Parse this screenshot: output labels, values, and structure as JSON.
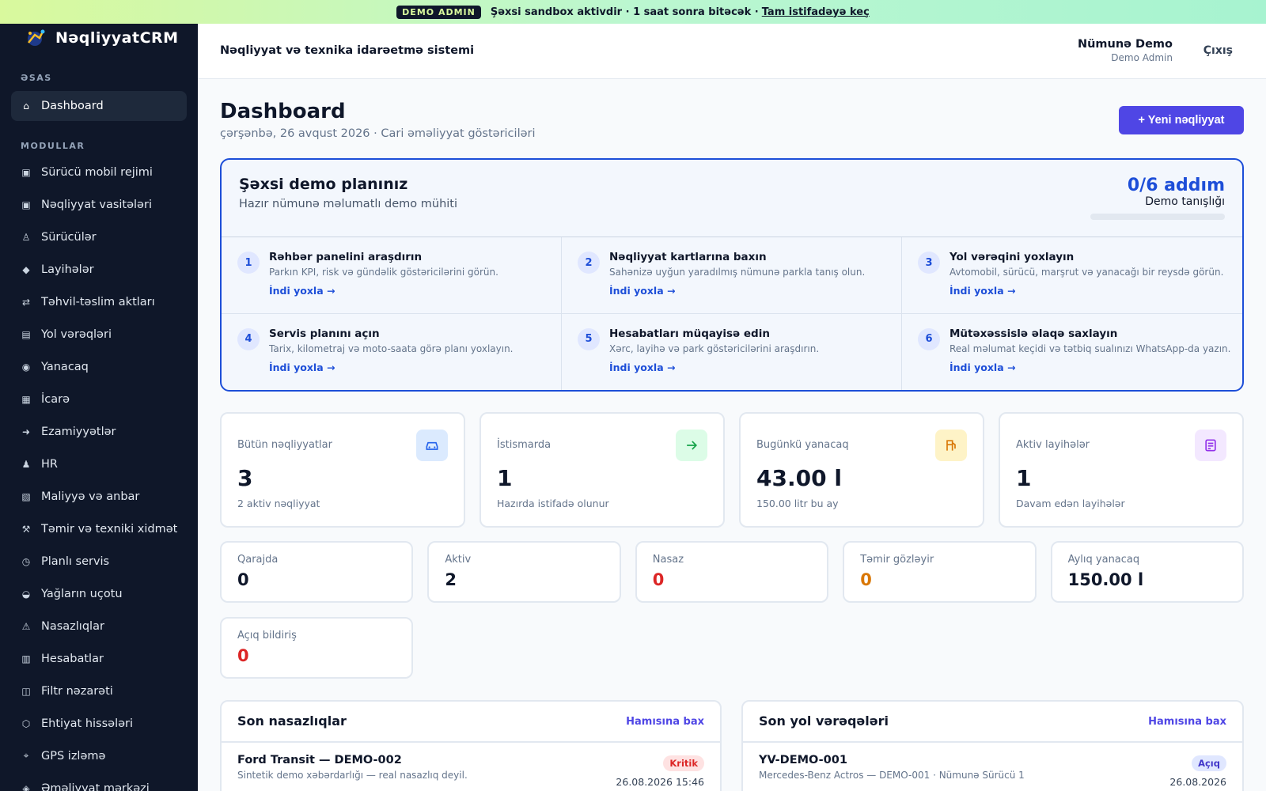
{
  "banner": {
    "badge": "DEMO ADMIN",
    "message": "Şəxsi sandbox aktivdir · 1 saat sonra bitəcək ·",
    "link": "Tam istifadəyə keç"
  },
  "sidebar": {
    "brand": "NəqliyyatCRM",
    "section_main": "ƏSAS",
    "dashboard": "Dashboard",
    "section_modules": "MODULLAR",
    "items": [
      {
        "label": "Sürücü mobil rejimi",
        "icon": "▣"
      },
      {
        "label": "Nəqliyyat vasitələri",
        "icon": "▣"
      },
      {
        "label": "Sürücülər",
        "icon": "♙"
      },
      {
        "label": "Layihələr",
        "icon": "◆"
      },
      {
        "label": "Təhvil-təslim aktları",
        "icon": "⇄"
      },
      {
        "label": "Yol vərəqləri",
        "icon": "▤"
      },
      {
        "label": "Yanacaq",
        "icon": "◉"
      },
      {
        "label": "İcarə",
        "icon": "▦"
      },
      {
        "label": "Ezamiyyətlər",
        "icon": "➜"
      },
      {
        "label": "HR",
        "icon": "♟"
      },
      {
        "label": "Maliyyə və anbar",
        "icon": "▧"
      },
      {
        "label": "Təmir və texniki xidmət",
        "icon": "⚒"
      },
      {
        "label": "Planlı servis",
        "icon": "◷"
      },
      {
        "label": "Yağların uçotu",
        "icon": "◒"
      },
      {
        "label": "Nasazlıqlar",
        "icon": "⚠"
      },
      {
        "label": "Hesabatlar",
        "icon": "▥"
      },
      {
        "label": "Filtr nəzarəti",
        "icon": "◫"
      },
      {
        "label": "Ehtiyat hissələri",
        "icon": "⬡"
      },
      {
        "label": "GPS izləmə",
        "icon": "⌖"
      },
      {
        "label": "Əməliyyat mərkəzi",
        "icon": "◈"
      }
    ]
  },
  "header": {
    "title": "Nəqliyyat və texnika idarəetmə sistemi",
    "user_name": "Nümunə Demo",
    "user_role": "Demo Admin",
    "logout": "Çıxış"
  },
  "main": {
    "title": "Dashboard",
    "subtitle": "çərşənbə, 26 avqust 2026 · Cari əməliyyat göstəriciləri",
    "new_button": "+ Yeni nəqliyyat"
  },
  "plan": {
    "title": "Şəxsi demo planınız",
    "subtitle": "Hazır nümunə məlumatlı demo mühiti",
    "count": "0/6 addım",
    "count_label": "Demo tanışlığı",
    "progress": 0,
    "steps": [
      {
        "num": "1",
        "title": "Rəhbər panelini araşdırın",
        "desc": "Parkın KPI, risk və gündəlik göstəricilərini görün.",
        "link": "İndi yoxla →"
      },
      {
        "num": "2",
        "title": "Nəqliyyat kartlarına baxın",
        "desc": "Sahənizə uyğun yaradılmış nümunə parkla tanış olun.",
        "link": "İndi yoxla →"
      },
      {
        "num": "3",
        "title": "Yol vərəqini yoxlayın",
        "desc": "Avtomobil, sürücü, marşrut və yanacağı bir reysdə görün.",
        "link": "İndi yoxla →"
      },
      {
        "num": "4",
        "title": "Servis planını açın",
        "desc": "Tarix, kilometraj və moto-saata görə planı yoxlayın.",
        "link": "İndi yoxla →"
      },
      {
        "num": "5",
        "title": "Hesabatları müqayisə edin",
        "desc": "Xərc, layihə və park göstəricilərini araşdırın.",
        "link": "İndi yoxla →"
      },
      {
        "num": "6",
        "title": "Mütəxəssislə əlaqə saxlayın",
        "desc": "Real məlumat keçidi və tətbiq sualınızı WhatsApp-da yazın.",
        "link": "İndi yoxla →"
      }
    ]
  },
  "kpis": [
    {
      "label": "Bütün nəqliyyatlar",
      "value": "3",
      "note": "2 aktiv nəqliyyat",
      "icon": "car-icon",
      "bg": "#dbeafe",
      "fg": "#2563eb"
    },
    {
      "label": "İstismarda",
      "value": "1",
      "note": "Hazırda istifadə olunur",
      "icon": "arrow-right-icon",
      "bg": "#dcfce7",
      "fg": "#16a34a"
    },
    {
      "label": "Bugünkü yanacaq",
      "value": "43.00 l",
      "note": "150.00 litr bu ay",
      "icon": "fuel-icon",
      "bg": "#fef3c7",
      "fg": "#d97706"
    },
    {
      "label": "Aktiv layihələr",
      "value": "1",
      "note": "Davam edən layihələr",
      "icon": "document-icon",
      "bg": "#f3e8ff",
      "fg": "#9333ea"
    }
  ],
  "stats": [
    {
      "label": "Qarajda",
      "value": "0",
      "color": "#0f172a"
    },
    {
      "label": "Aktiv",
      "value": "2",
      "color": "#0f172a"
    },
    {
      "label": "Nasaz",
      "value": "0",
      "color": "#dc2626"
    },
    {
      "label": "Təmir gözləyir",
      "value": "0",
      "color": "#d97706"
    },
    {
      "label": "Aylıq yanacaq",
      "value": "150.00 l",
      "color": "#0f172a"
    }
  ],
  "stat_extra": {
    "label": "Açıq bildiriş",
    "value": "0",
    "color": "#dc2626"
  },
  "faults": {
    "title": "Son nasazlıqlar",
    "link": "Hamısına bax",
    "row_title": "Ford Transit — DEMO-002",
    "row_sub": "Sintetik demo xəbərdarlığı — real nasazlıq deyil.",
    "badge": "Kritik",
    "badge_bg": "#fee2e2",
    "badge_fg": "#dc2626",
    "date": "26.08.2026 15:46"
  },
  "waybills": {
    "title": "Son yol vərəqələri",
    "link": "Hamısına bax",
    "row_title": "YV-DEMO-001",
    "row_sub": "Mercedes-Benz Actros — DEMO-001 · Nümunə Sürücü 1",
    "badge": "Açıq",
    "badge_bg": "#e0e7ff",
    "badge_fg": "#4338ca",
    "date": "26.08.2026"
  }
}
